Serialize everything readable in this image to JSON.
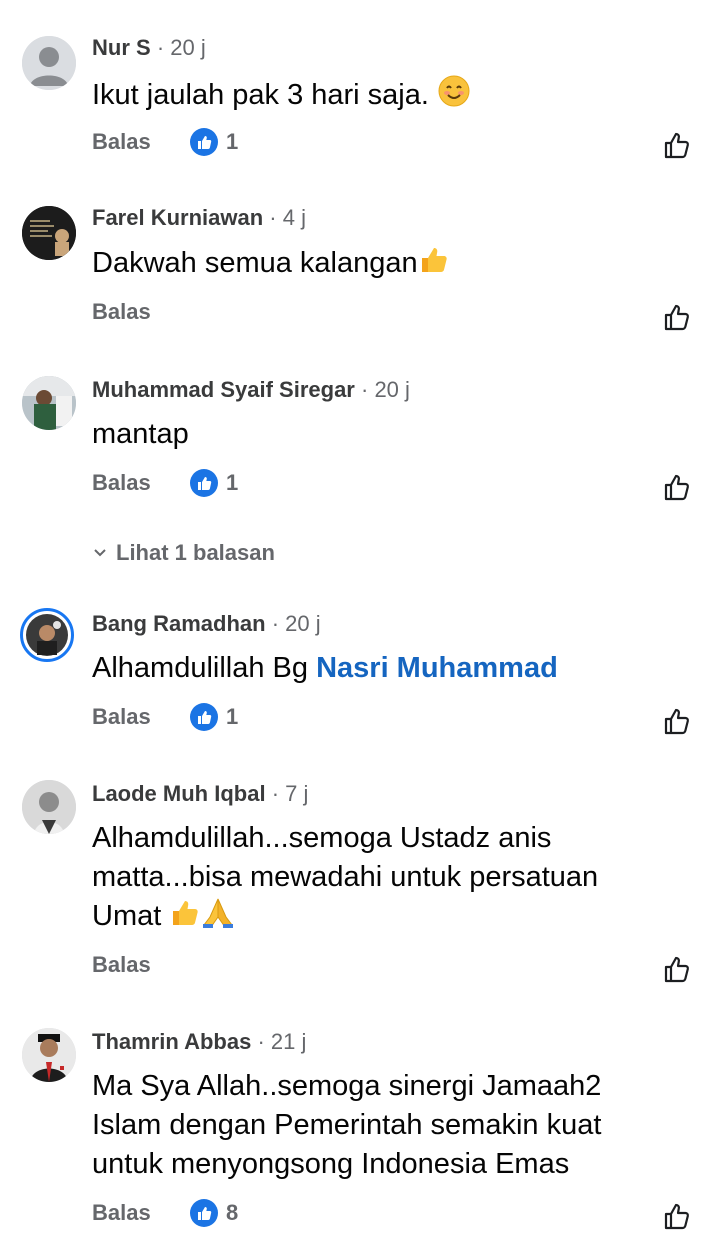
{
  "reply_label": "Balas",
  "comments": [
    {
      "author": "Nur S",
      "time": "· 20 j",
      "text": "Ikut jaulah pak 3 hari saja.",
      "emoji": "smiling-face",
      "reaction_count": "1"
    },
    {
      "author": "Farel Kurniawan",
      "time": "· 4 j",
      "text": "Dakwah semua kalangan",
      "emoji": "thumbs-up",
      "reaction_count": ""
    },
    {
      "author": "Muhammad Syaif Siregar",
      "time": "· 20 j",
      "text": "mantap",
      "reaction_count": "1",
      "view_replies": "Lihat 1 balasan"
    },
    {
      "author": "Bang Ramadhan",
      "time": "· 20 j",
      "text": "Alhamdulillah Bg",
      "mention": "Nasri Muhammad",
      "reaction_count": "1"
    },
    {
      "author": "Laode Muh Iqbal",
      "time": "· 7 j",
      "text_lines": [
        "Alhamdulillah...semoga Ustadz anis",
        "matta...bisa mewadahi untuk persatuan",
        "Umat"
      ],
      "emoji": "thumbs-up, folded-hands",
      "reaction_count": ""
    },
    {
      "author": "Thamrin Abbas",
      "time": "· 21 j",
      "text_lines": [
        "Ma Sya Allah..semoga sinergi Jamaah2",
        "Islam dengan Pemerintah semakin kuat",
        "untuk menyongsong Indonesia Emas"
      ],
      "reaction_count": "8"
    }
  ],
  "colors": {
    "accent": "#1b74e4",
    "mention": "#1565c0",
    "secondary_text": "#65676b"
  }
}
